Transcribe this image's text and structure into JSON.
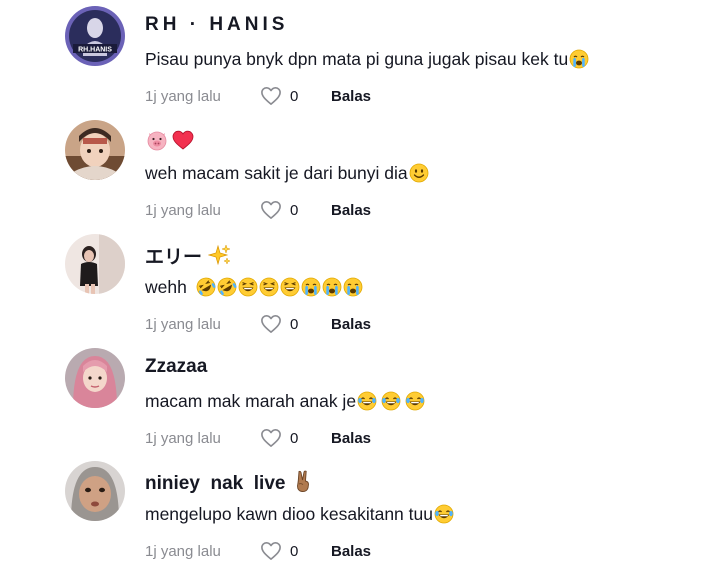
{
  "comments": [
    {
      "username": "RH · HANIS",
      "avatar_text": "RH.HANIS",
      "text": "Pisau punya bnyk dpn mata pi guna jugak pisau kek tu",
      "text_emojis": [
        "crying-face-icon"
      ],
      "time": "1j yang lalu",
      "likes": "0",
      "reply_label": "Balas"
    },
    {
      "username": "",
      "username_emojis": [
        "pig-face-icon",
        "heart-icon"
      ],
      "text": "weh macam sakit je dari bunyi dia",
      "text_emojis": [
        "smiling-face-icon"
      ],
      "time": "1j yang lalu",
      "likes": "0",
      "reply_label": "Balas"
    },
    {
      "username": "エリー",
      "username_emojis": [
        "sparkles-icon"
      ],
      "text": "wehh",
      "text_emojis": [
        "rofl-icon",
        "rofl-icon",
        "laughing-face-icon",
        "laughing-face-icon",
        "laughing-face-icon",
        "crying-face-icon",
        "crying-face-icon",
        "crying-face-icon"
      ],
      "time": "1j yang lalu",
      "likes": "0",
      "reply_label": "Balas"
    },
    {
      "username": "Zzazaa",
      "text": "macam mak marah anak je",
      "text_emojis": [
        "tears-of-joy-icon",
        "tears-of-joy-icon",
        "tears-of-joy-icon"
      ],
      "time": "1j yang lalu",
      "likes": "0",
      "reply_label": "Balas"
    },
    {
      "username": "niniey  nak  live",
      "username_emojis": [
        "victory-hand-icon"
      ],
      "text": "mengelupo kawn dioo kesakitann tuu",
      "text_emojis": [
        "tears-of-joy-icon"
      ],
      "time": "1j yang lalu",
      "likes": "0",
      "reply_label": "Balas"
    }
  ],
  "colors": {
    "primary_text": "#161823",
    "secondary_text": "#8a8b91",
    "background": "#ffffff"
  }
}
